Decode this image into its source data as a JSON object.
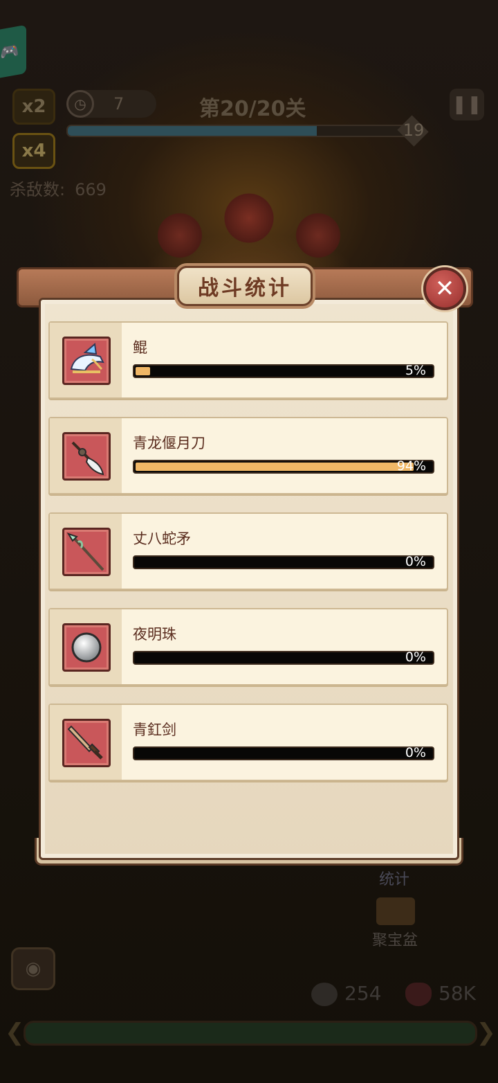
{
  "hud": {
    "speed_x2": "x2",
    "speed_x4": "x4",
    "wave_count": "7",
    "level": "第20/20关",
    "level_end": "19",
    "kill_label": "杀敌数:",
    "kill_count": "669",
    "stat_button_label": "统计",
    "treasure_label": "聚宝盆",
    "coins": "254",
    "hp": "58K",
    "level_progress": 0.72
  },
  "panel": {
    "title": "战斗统计",
    "close_label": "✕"
  },
  "weapons": [
    {
      "name": "鲲",
      "percent_text": "5%",
      "percent": 5,
      "icon": "kun-fish-icon"
    },
    {
      "name": "青龙偃月刀",
      "percent_text": "94%",
      "percent": 94,
      "icon": "crescent-blade-icon"
    },
    {
      "name": "丈八蛇矛",
      "percent_text": "0%",
      "percent": 0,
      "icon": "serpent-spear-icon"
    },
    {
      "name": "夜明珠",
      "percent_text": "0%",
      "percent": 0,
      "icon": "pearl-icon"
    },
    {
      "name": "青釭剑",
      "percent_text": "0%",
      "percent": 0,
      "icon": "sword-icon"
    }
  ],
  "colors": {
    "bar_fill": "#f0b766",
    "bar_track": "#080706",
    "icon_frame": "#c9575a",
    "close_button": "#b2403c"
  }
}
